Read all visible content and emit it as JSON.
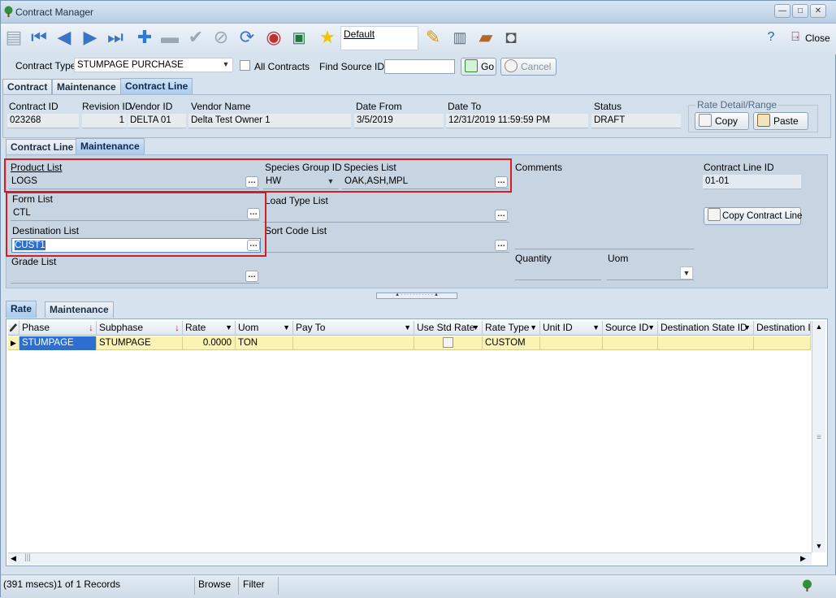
{
  "window": {
    "title": "Contract Manager"
  },
  "toolbar": {
    "default_label": "Default",
    "close_label": "Close"
  },
  "filters": {
    "contract_type_label": "Contract Type",
    "contract_type_value": "STUMPAGE PURCHASE",
    "all_contracts_label": "All Contracts",
    "find_source_label": "Find Source ID:",
    "find_source_value": "",
    "go_label": "Go",
    "cancel_label": "Cancel"
  },
  "main_tabs": [
    "Contract",
    "Maintenance",
    "Contract Line"
  ],
  "header": {
    "contract_id_label": "Contract ID",
    "contract_id": "023268",
    "revision_id_label": "Revision ID",
    "revision_id": "1",
    "vendor_id_label": "Vendor ID",
    "vendor_id": "DELTA 01",
    "vendor_name_label": "Vendor Name",
    "vendor_name": "Delta Test Owner 1",
    "date_from_label": "Date From",
    "date_from": "3/5/2019",
    "date_to_label": "Date To",
    "date_to": "12/31/2019 11:59:59 PM",
    "status_label": "Status",
    "status": "DRAFT",
    "rate_detail_label": "Rate Detail/Range",
    "copy_label": "Copy",
    "paste_label": "Paste"
  },
  "sub_tabs": [
    "Contract Line",
    "Maintenance"
  ],
  "line": {
    "product_list_label": "Product List",
    "product_list": "LOGS",
    "species_group_label": "Species Group ID",
    "species_group": "HW",
    "species_list_label": "Species List",
    "species_list": "OAK,ASH,MPL",
    "comments_label": "Comments",
    "contract_line_id_label": "Contract Line ID",
    "contract_line_id": "01-01",
    "form_list_label": "Form List",
    "form_list": "CTL",
    "load_type_label": "Load Type List",
    "load_type": "",
    "copy_line_label": "Copy Contract Line",
    "destination_list_label": "Destination List",
    "destination_list": "CUST1",
    "sort_code_label": "Sort Code List",
    "sort_code": "",
    "grade_list_label": "Grade List",
    "grade_list": "",
    "quantity_label": "Quantity",
    "quantity": "",
    "uom_label": "Uom",
    "uom": ""
  },
  "rate_tabs": [
    "Rate",
    "Maintenance"
  ],
  "grid": {
    "columns": [
      "Phase",
      "Subphase",
      "Rate",
      "Uom",
      "Pay To",
      "Use Std Rate",
      "Rate Type",
      "Unit ID",
      "Source ID",
      "Destination State ID",
      "Destination ID"
    ],
    "rows": [
      {
        "phase": "STUMPAGE",
        "subphase": "STUMPAGE",
        "rate": "0.0000",
        "uom": "TON",
        "pay_to": "",
        "use_std_rate": false,
        "rate_type": "CUSTOM",
        "unit_id": "",
        "source_id": "",
        "dest_state_id": "",
        "dest_id": ""
      }
    ]
  },
  "status_bar": {
    "records": "(391 msecs)1 of 1 Records",
    "browse": "Browse",
    "filter": "Filter"
  },
  "colors": {
    "highlight": "#d21f26",
    "selected_row": "#fbf3b5",
    "accent": "#3b74c4"
  }
}
